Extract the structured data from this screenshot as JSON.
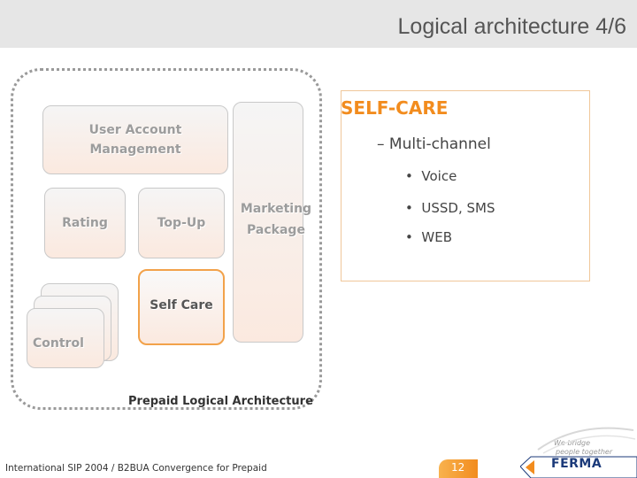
{
  "header": {
    "title": "Logical architecture 4/6"
  },
  "diagram": {
    "user_account_management": "User Account Management",
    "rating": "Rating",
    "top_up": "Top-Up",
    "marketing_package": "Marketing Package",
    "self_care": "Self Care",
    "control": "Control",
    "caption": "Prepaid Logical Architecture"
  },
  "panel": {
    "heading": "SELF-CARE",
    "level1": "– Multi-channel",
    "level2": [
      "Voice",
      "USSD, SMS",
      "WEB"
    ]
  },
  "footer": {
    "text": "International SIP 2004 / B2BUA Convergence for Prepaid",
    "page_number": "12",
    "tagline_line1": "We bridge",
    "tagline_line2": "people together",
    "logo": "FERMA"
  },
  "colors": {
    "accent": "#f28c1e",
    "frame": "#9a9a9a",
    "logo": "#1b3a7a"
  }
}
